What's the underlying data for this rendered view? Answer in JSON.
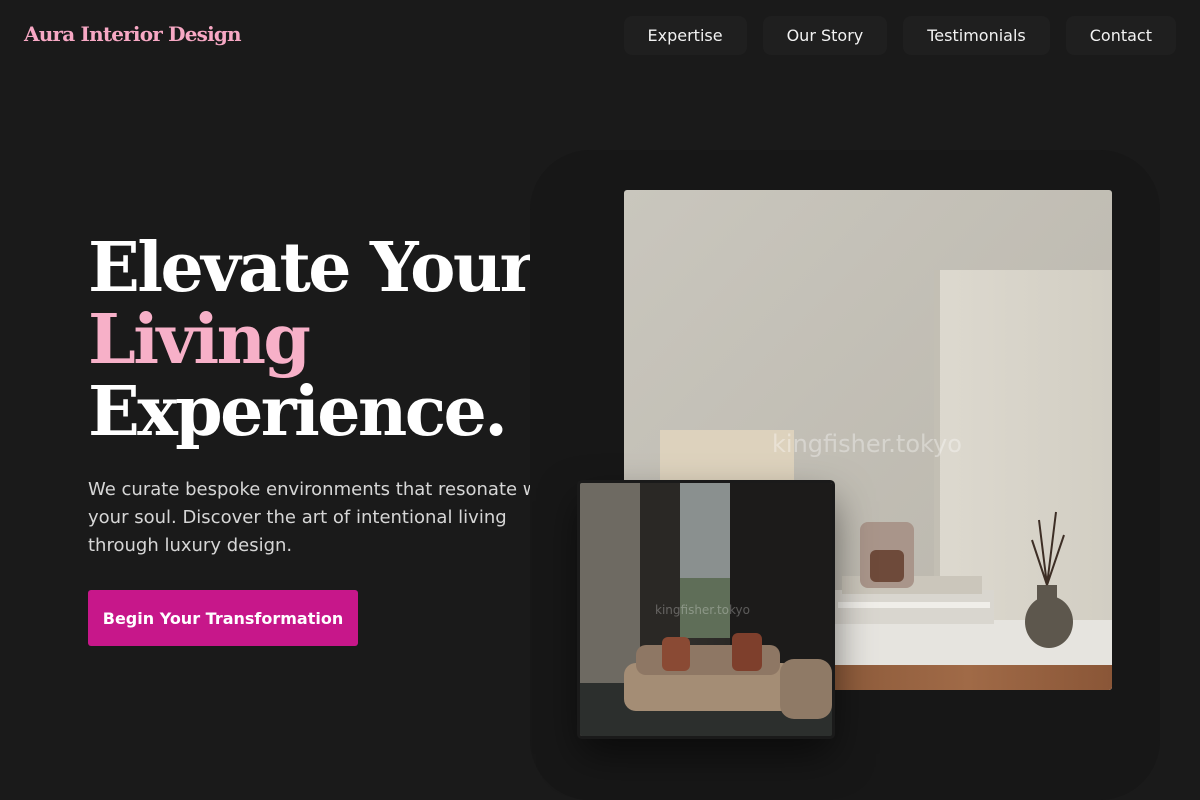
{
  "brand": {
    "name": "Aura Interior Design"
  },
  "nav": {
    "items": [
      {
        "label": "Expertise"
      },
      {
        "label": "Our Story"
      },
      {
        "label": "Testimonials"
      },
      {
        "label": "Contact"
      }
    ]
  },
  "hero": {
    "headline_line1": "Elevate Your",
    "headline_accent": "Living",
    "headline_line3": "Experience.",
    "description": "We curate bespoke environments that resonate with your soul. Discover the art of intentional living through luxury design.",
    "cta_label": "Begin Your Transformation"
  },
  "images": {
    "main_watermark": "kingfisher.tokyo",
    "inset_watermark": "kingfisher.tokyo"
  },
  "colors": {
    "background": "#1a1a1a",
    "brand_pink": "#f7a8c4",
    "accent_pink": "#f7b0c8",
    "cta_magenta": "#c7178a"
  }
}
